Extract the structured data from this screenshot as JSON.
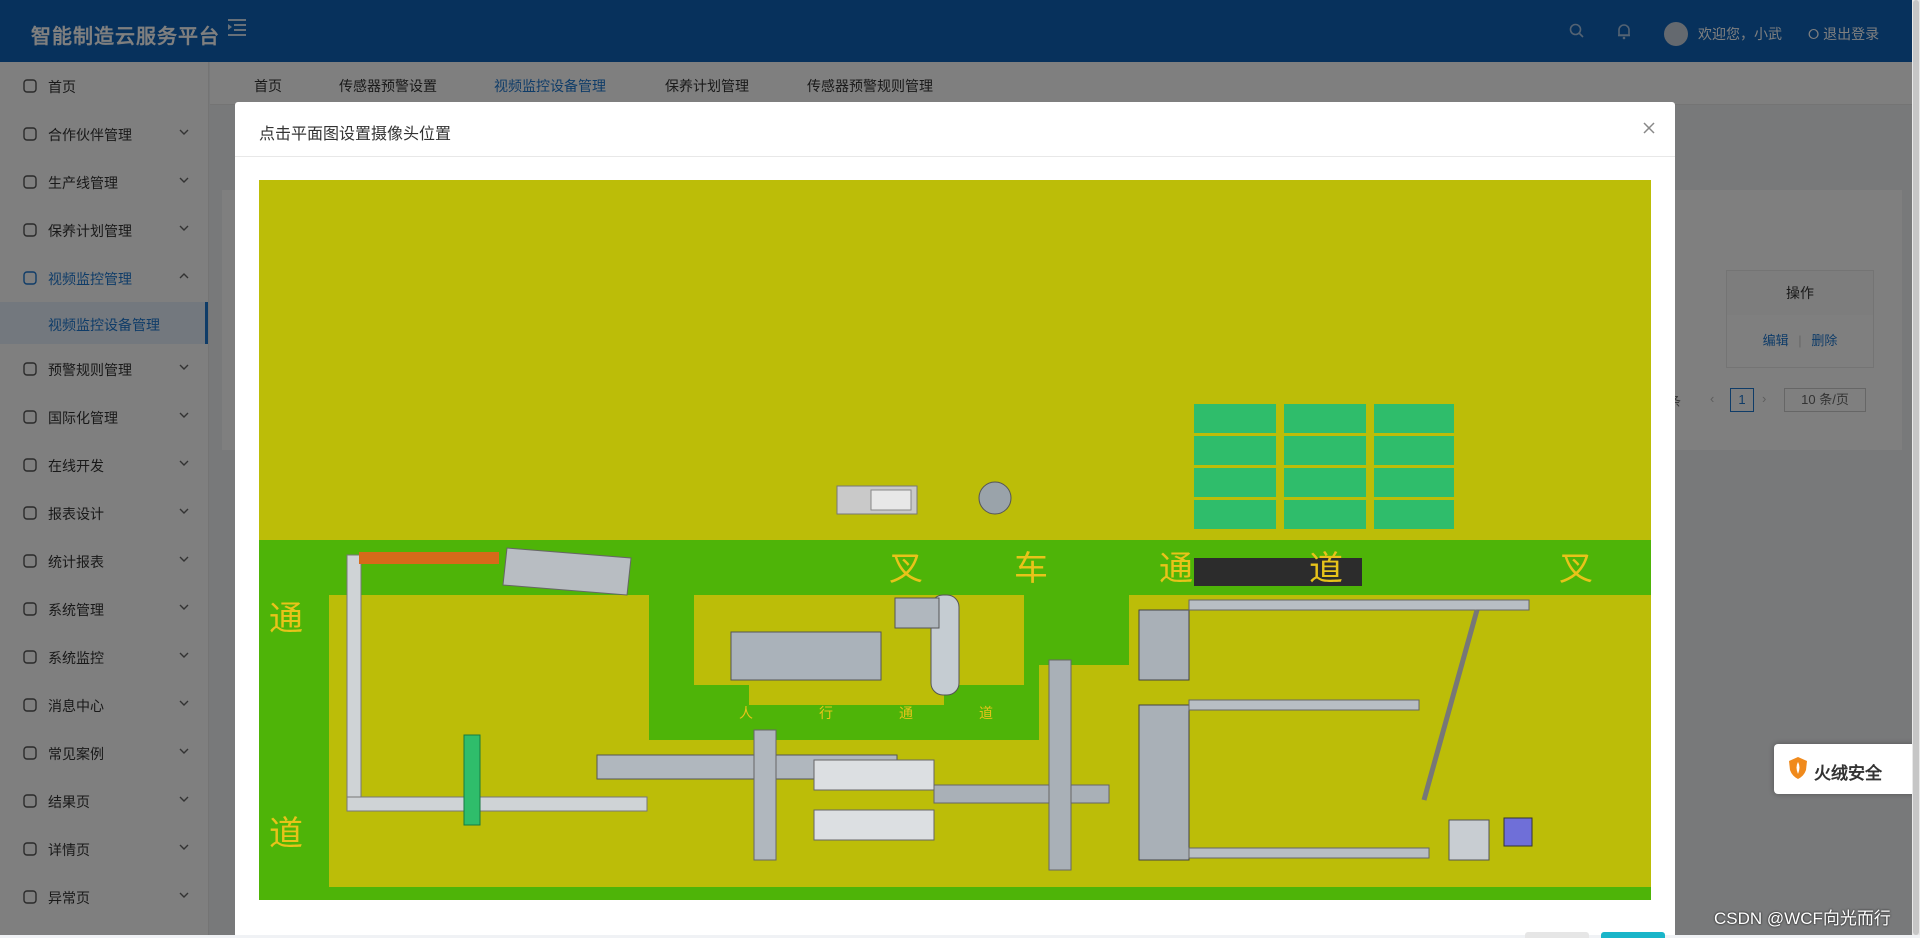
{
  "app": {
    "title": "智能制造云服务平台"
  },
  "header": {
    "welcome": "欢迎您，小武",
    "logout": "退出登录"
  },
  "sidebar": {
    "items": [
      {
        "label": "首页",
        "icon": "home-icon"
      },
      {
        "label": "合作伙伴管理",
        "icon": "user-icon"
      },
      {
        "label": "生产线管理",
        "icon": "list-icon"
      },
      {
        "label": "保养计划管理",
        "icon": "wrench-icon"
      },
      {
        "label": "视频监控管理",
        "icon": "play-circle-icon"
      },
      {
        "label": "预警规则管理",
        "icon": "table-icon"
      },
      {
        "label": "国际化管理",
        "icon": "globe-icon"
      },
      {
        "label": "在线开发",
        "icon": "cloud-icon"
      },
      {
        "label": "报表设计",
        "icon": "area-chart-icon"
      },
      {
        "label": "统计报表",
        "icon": "bar-chart-icon"
      },
      {
        "label": "系统管理",
        "icon": "gear-icon"
      },
      {
        "label": "系统监控",
        "icon": "dashboard-icon"
      },
      {
        "label": "消息中心",
        "icon": "message-icon"
      },
      {
        "label": "常见案例",
        "icon": "grid-icon"
      },
      {
        "label": "结果页",
        "icon": "check-circle-icon"
      },
      {
        "label": "详情页",
        "icon": "profile-icon"
      },
      {
        "label": "异常页",
        "icon": "warning-icon"
      }
    ],
    "sub_item": "视频监控设备管理"
  },
  "tabs": [
    "首页",
    "传感器预警设置",
    "视频监控设备管理",
    "保养计划管理",
    "传感器预警规则管理"
  ],
  "table": {
    "op_header": "操作",
    "edit": "编辑",
    "divider": "|",
    "delete": "删除"
  },
  "pager": {
    "total_suffix": "条",
    "current": "1",
    "page_size": "10 条/页"
  },
  "modal": {
    "title": "点击平面图设置摄像头位置",
    "close": "×"
  },
  "floorplan": {
    "labels_top": [
      "叉",
      "车",
      "通",
      "道",
      "叉"
    ],
    "label_left_top": "通",
    "label_left_bottom": "道",
    "labels_inner": [
      "人",
      "行",
      "通",
      "道"
    ]
  },
  "colors": {
    "header": "#0f63b8",
    "accent": "#1f78d1",
    "floor": "#bcbd08",
    "aisle": "#4eb408",
    "storage": "#2fbd6b"
  },
  "floating_badge": "火绒安全",
  "watermark": "CSDN @WCF向光而行"
}
